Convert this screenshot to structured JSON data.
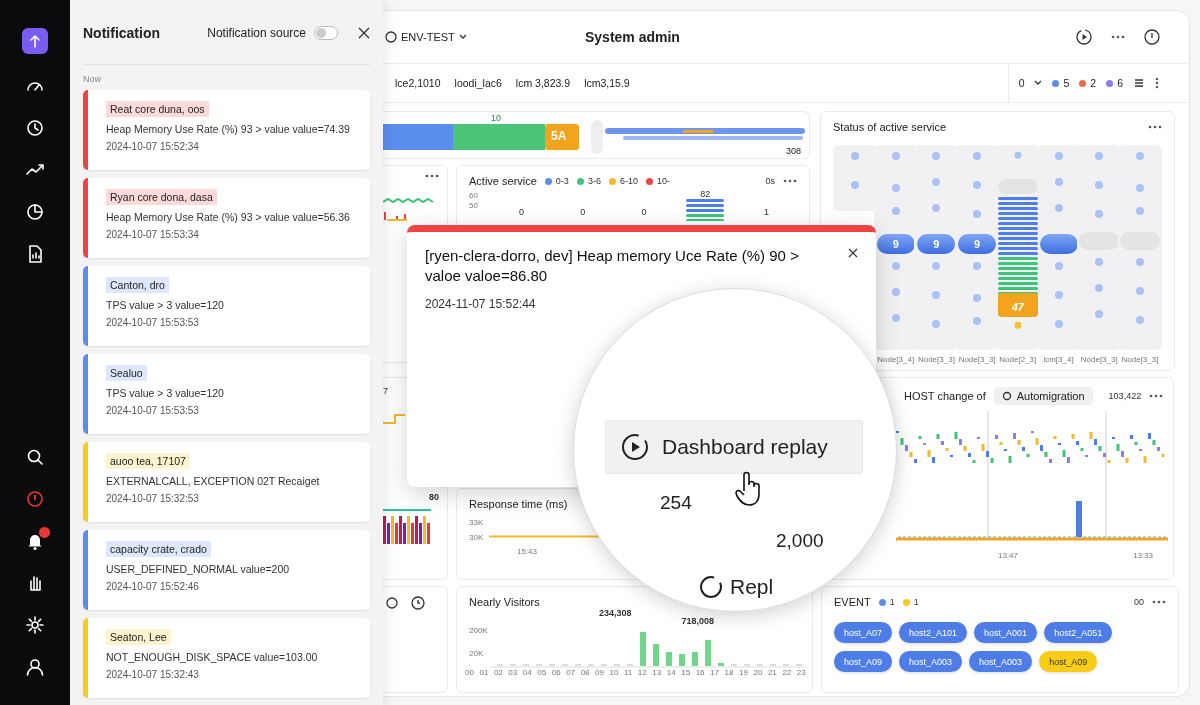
{
  "notifications": {
    "title": "Notification",
    "source_label": "Notification source",
    "source_on": false,
    "group_label": "Now",
    "items": [
      {
        "tag": "Reat core duna, oos",
        "message": "Heap Memory Use Rate (%) 93 > value value=74.39",
        "time": "2024-10-07 15:52:34",
        "color": "#ef4444"
      },
      {
        "tag": "Ryan core dona, dasa",
        "message": "Heap Memory Use Rate (%) 93 > value value=56.36",
        "time": "2024-10-07 15:53:34",
        "color": "#ef4444"
      },
      {
        "tag": "Canton, dro",
        "message": "TPS value > 3 value=120",
        "time": "2024-10-07 15:53:53",
        "color": "#5b8def"
      },
      {
        "tag": "Sealuo",
        "message": "TPS value > 3 value=120",
        "time": "2024-10-07 15:53:53",
        "color": "#5b8def"
      },
      {
        "tag": "auoo tea, 17107",
        "message": "EXTERNALCALL, EXCEPTION 02T Recaiget",
        "time": "2024-10-07 15:32:53",
        "color": "#facc15"
      },
      {
        "tag": "capacity crate, crado",
        "message": "USER_DEFINED_NORMAL value=200",
        "time": "2024-10-07 15:52:46",
        "color": "#5b8def"
      },
      {
        "tag": "Seaton, Lee",
        "message": "NOT_ENOUGH_DISK_SPACE value=103.00",
        "time": "2024-10-07 15:32:43",
        "color": "#facc15"
      }
    ]
  },
  "dashboard": {
    "env": "ENV-TEST",
    "title": "System admin",
    "filters": [
      "lce2,1010",
      "loodi_lac6",
      "lcm 3,823.9",
      "lcm3,15.9"
    ],
    "counter": "0",
    "legend": [
      {
        "count": "5",
        "color": "#5b8def"
      },
      {
        "count": "2",
        "color": "#ef6a4c"
      },
      {
        "count": "6",
        "color": "#8b7cf0"
      }
    ],
    "overview": {
      "segment_label": "10",
      "badge": "5A",
      "total": "308"
    },
    "side_values": [
      "7",
      "80"
    ],
    "active_service": {
      "title": "Active service",
      "extra": "0s",
      "legend": [
        {
          "label": "0-3",
          "color": "#5b8def"
        },
        {
          "label": "3-6",
          "color": "#3ec47a"
        },
        {
          "label": "6-10",
          "color": "#f5b82e"
        },
        {
          "label": "10-",
          "color": "#ef4444"
        }
      ],
      "yticks": [
        "60",
        "50"
      ],
      "value_labels": [
        {
          "value": "0",
          "kind": "text"
        },
        {
          "value": "0",
          "kind": "text"
        },
        {
          "value": "0",
          "kind": "text"
        },
        {
          "value": "82",
          "kind": "bar"
        },
        {
          "value": "1",
          "kind": "text"
        }
      ]
    },
    "status_service": {
      "title": "Status of active service",
      "columns": [
        {
          "kind": "dots"
        },
        {
          "kind": "pill",
          "value": "9",
          "label": "Node[3_4]"
        },
        {
          "kind": "pill",
          "value": "9",
          "label": "Node[3_3]"
        },
        {
          "kind": "pill",
          "value": "9",
          "label": "Node[3_3]"
        },
        {
          "kind": "stack",
          "value": "47",
          "label": "Node[2_3]"
        },
        {
          "kind": "pill",
          "label": "lcm[3_4]"
        },
        {
          "kind": "gap",
          "label": "Node[3_3]"
        },
        {
          "kind": "gap",
          "label": "Node[3_3]"
        }
      ]
    },
    "response_time": {
      "title": "Response time (ms)",
      "yticks": [
        "33K",
        "30K"
      ],
      "xticks": [
        "15:43"
      ]
    },
    "host_change": {
      "title": "HOST change of",
      "chip": "Automigration",
      "count": "103,422",
      "xticks": [
        "13:47",
        "13:33"
      ]
    },
    "visitors": {
      "title": "Nearly Visitors",
      "peaks": [
        "234,308",
        "718,008"
      ],
      "yticks": [
        "200K",
        "20K"
      ],
      "xticks": [
        "00",
        "01",
        "02",
        "03",
        "04",
        "05",
        "06",
        "07",
        "08",
        "09",
        "10",
        "11",
        "12",
        "13",
        "14",
        "15",
        "16",
        "17",
        "18",
        "19",
        "20",
        "21",
        "22",
        "23"
      ]
    },
    "event": {
      "title": "EVENT",
      "extra": "00",
      "legend": [
        {
          "count": "1",
          "color": "#5b8def"
        },
        {
          "count": "1",
          "color": "#facc15"
        }
      ],
      "chips": [
        {
          "label": "host_A07",
          "color": "#4f7de8"
        },
        {
          "label": "host2_A101",
          "color": "#4f7de8"
        },
        {
          "label": "host_A001",
          "color": "#4f7de8"
        },
        {
          "label": "host2_A051",
          "color": "#4f7de8"
        },
        {
          "label": "host_A09",
          "color": "#4f7de8"
        },
        {
          "label": "host_A003",
          "color": "#4f7de8"
        },
        {
          "label": "host_A003",
          "color": "#4f7de8"
        },
        {
          "label": "host_A09",
          "color": "#facc15"
        }
      ]
    }
  },
  "alert_modal": {
    "title": "[ryen-clera-dorro, dev] Heap memory Uce Rate (%) 90 > valoe valoe=86.80",
    "time": "2024-11-07 15:52:44"
  },
  "replay_lens": {
    "button": "Dashboard replay",
    "values": [
      "254",
      "2,000"
    ],
    "partial": "Repl"
  }
}
